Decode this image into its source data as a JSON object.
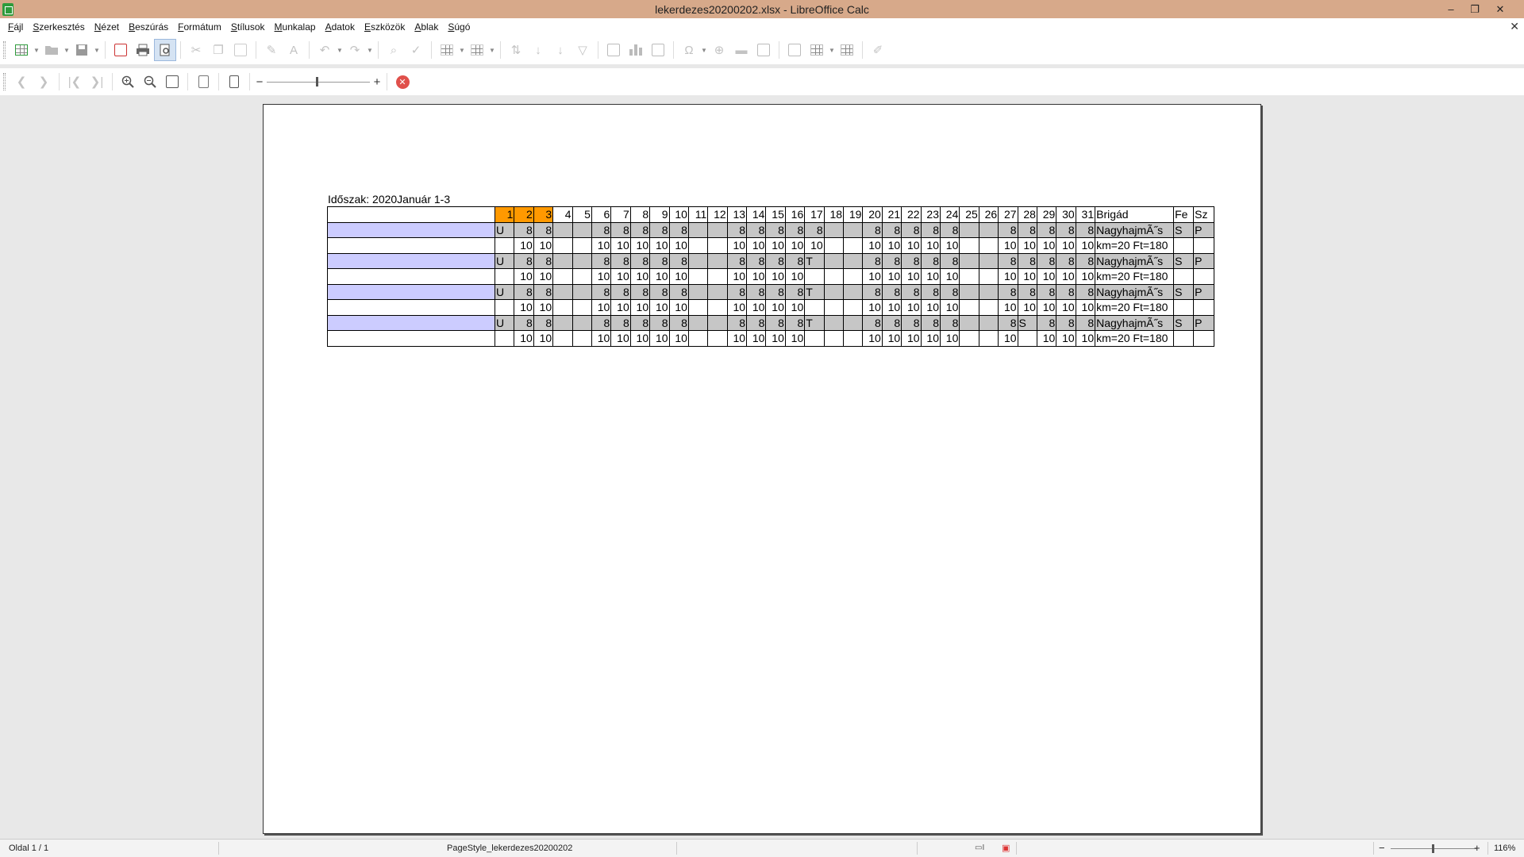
{
  "window": {
    "title": "lekerdezes20200202.xlsx - LibreOffice Calc",
    "minimize_glyph": "–",
    "maximize_glyph": "❐",
    "close_glyph": "✕"
  },
  "menubar": {
    "items": [
      "Fájl",
      "Szerkesztés",
      "Nézet",
      "Beszúrás",
      "Formátum",
      "Stílusok",
      "Munkalap",
      "Adatok",
      "Eszközök",
      "Ablak",
      "Súgó"
    ],
    "close_glyph": "✕"
  },
  "toolbar": {
    "zoom_out_glyph": "−",
    "zoom_in_glyph": "+",
    "close_glyph": "✕",
    "icons": {
      "new": "new-spreadsheet-icon",
      "open": "open-folder-icon",
      "save": "save-icon",
      "export_pdf": "export-pdf-icon",
      "print": "print-icon",
      "print_preview": "print-preview-icon",
      "cut": "cut-icon",
      "copy": "copy-icon",
      "paste": "paste-icon",
      "clone": "clone-formatting-icon",
      "clear": "clear-formatting-icon",
      "undo": "undo-icon",
      "redo": "redo-icon",
      "find": "find-replace-icon",
      "spelling": "spelling-icon",
      "row": "row-icon",
      "column": "column-icon",
      "sort": "sort-icon",
      "sort_asc": "sort-ascending-icon",
      "sort_desc": "sort-descending-icon",
      "autofilter": "autofilter-icon",
      "image": "insert-image-icon",
      "chart": "insert-chart-icon",
      "pivot": "pivot-table-icon",
      "special_char": "special-character-icon",
      "hyperlink": "hyperlink-icon",
      "comment": "comment-icon",
      "header_footer": "header-footer-icon",
      "define_print": "define-print-area-icon",
      "freeze": "freeze-rows-columns-icon",
      "split": "split-window-icon",
      "draw": "show-draw-functions-icon"
    }
  },
  "sheet": {
    "period_label": "Időszak: 2020Január 1-3",
    "header": {
      "days": [
        "1",
        "2",
        "3",
        "4",
        "5",
        "6",
        "7",
        "8",
        "9",
        "10",
        "11",
        "12",
        "13",
        "14",
        "15",
        "16",
        "17",
        "18",
        "19",
        "20",
        "21",
        "22",
        "23",
        "24",
        "25",
        "26",
        "27",
        "28",
        "29",
        "30",
        "31"
      ],
      "brigad": "Brigád",
      "fe": "Fe",
      "sz": "Sz"
    },
    "rows": [
      {
        "shaded": true,
        "name": "",
        "days": [
          "U",
          "8",
          "8",
          "",
          "",
          "8",
          "8",
          "8",
          "8",
          "8",
          "",
          "",
          "8",
          "8",
          "8",
          "8",
          "8",
          "",
          "",
          "8",
          "8",
          "8",
          "8",
          "8",
          "",
          "",
          "8",
          "8",
          "8",
          "8",
          "8"
        ],
        "brigad": "NagyhajmÃ˝s",
        "fe": "S",
        "sz": "P"
      },
      {
        "shaded": false,
        "name": "",
        "days": [
          "",
          "10",
          "10",
          "",
          "",
          "10",
          "10",
          "10",
          "10",
          "10",
          "",
          "",
          "10",
          "10",
          "10",
          "10",
          "10",
          "",
          "",
          "10",
          "10",
          "10",
          "10",
          "10",
          "",
          "",
          "10",
          "10",
          "10",
          "10",
          "10"
        ],
        "brigad": "km=20 Ft=180",
        "fe": "",
        "sz": ""
      },
      {
        "shaded": true,
        "name": "",
        "days": [
          "U",
          "8",
          "8",
          "",
          "",
          "8",
          "8",
          "8",
          "8",
          "8",
          "",
          "",
          "8",
          "8",
          "8",
          "8",
          "T",
          "",
          "",
          "8",
          "8",
          "8",
          "8",
          "8",
          "",
          "",
          "8",
          "8",
          "8",
          "8",
          "8"
        ],
        "brigad": "NagyhajmÃ˝s",
        "fe": "S",
        "sz": "P"
      },
      {
        "shaded": false,
        "name": "",
        "days": [
          "",
          "10",
          "10",
          "",
          "",
          "10",
          "10",
          "10",
          "10",
          "10",
          "",
          "",
          "10",
          "10",
          "10",
          "10",
          "",
          "",
          "",
          "10",
          "10",
          "10",
          "10",
          "10",
          "",
          "",
          "10",
          "10",
          "10",
          "10",
          "10"
        ],
        "brigad": "km=20 Ft=180",
        "fe": "",
        "sz": ""
      },
      {
        "shaded": true,
        "name": "",
        "days": [
          "U",
          "8",
          "8",
          "",
          "",
          "8",
          "8",
          "8",
          "8",
          "8",
          "",
          "",
          "8",
          "8",
          "8",
          "8",
          "T",
          "",
          "",
          "8",
          "8",
          "8",
          "8",
          "8",
          "",
          "",
          "8",
          "8",
          "8",
          "8",
          "8"
        ],
        "brigad": "NagyhajmÃ˝s",
        "fe": "S",
        "sz": "P"
      },
      {
        "shaded": false,
        "name": "",
        "days": [
          "",
          "10",
          "10",
          "",
          "",
          "10",
          "10",
          "10",
          "10",
          "10",
          "",
          "",
          "10",
          "10",
          "10",
          "10",
          "",
          "",
          "",
          "10",
          "10",
          "10",
          "10",
          "10",
          "",
          "",
          "10",
          "10",
          "10",
          "10",
          "10"
        ],
        "brigad": "km=20 Ft=180",
        "fe": "",
        "sz": ""
      },
      {
        "shaded": true,
        "name": "",
        "days": [
          "U",
          "8",
          "8",
          "",
          "",
          "8",
          "8",
          "8",
          "8",
          "8",
          "",
          "",
          "8",
          "8",
          "8",
          "8",
          "T",
          "",
          "",
          "8",
          "8",
          "8",
          "8",
          "8",
          "",
          "",
          "8",
          "S",
          "8",
          "8",
          "8"
        ],
        "brigad": "NagyhajmÃ˝s",
        "fe": "S",
        "sz": "P"
      },
      {
        "shaded": false,
        "name": "",
        "days": [
          "",
          "10",
          "10",
          "",
          "",
          "10",
          "10",
          "10",
          "10",
          "10",
          "",
          "",
          "10",
          "10",
          "10",
          "10",
          "",
          "",
          "",
          "10",
          "10",
          "10",
          "10",
          "10",
          "",
          "",
          "10",
          "",
          "10",
          "10",
          "10"
        ],
        "brigad": "km=20 Ft=180",
        "fe": "",
        "sz": ""
      }
    ],
    "colors": {
      "highlight_days": "#ff9900",
      "shaded_row": "#c6c6c6",
      "name_shade": "#ccccff"
    }
  },
  "statusbar": {
    "page": "Oldal 1 / 1",
    "page_style": "PageStyle_lekerdezes20200202",
    "zoom_minus": "−",
    "zoom_plus": "+",
    "zoom": "116%"
  }
}
